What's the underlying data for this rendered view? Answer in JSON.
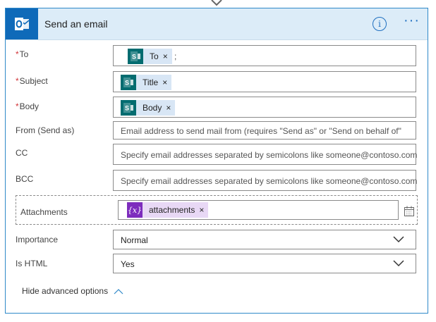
{
  "card": {
    "title": "Send an email",
    "info_glyph": "i",
    "more_glyph": "···",
    "accent_color": "#0f6ab9",
    "header_bg": "#dcecf8"
  },
  "fields": {
    "to": {
      "label": "To",
      "required_mark": "*",
      "token": "To",
      "separator": ";"
    },
    "subject": {
      "label": "Subject",
      "required_mark": "*",
      "token": "Title"
    },
    "body": {
      "label": "Body",
      "required_mark": "*",
      "token": "Body"
    },
    "from": {
      "label": "From (Send as)",
      "placeholder": "Email address to send mail from (requires \"Send as\" or \"Send on behalf of\""
    },
    "cc": {
      "label": "CC",
      "placeholder": "Specify email addresses separated by semicolons like someone@contoso.com"
    },
    "bcc": {
      "label": "BCC",
      "placeholder": "Specify email addresses separated by semicolons like someone@contoso.com"
    },
    "attachments": {
      "label": "Attachments",
      "token": "attachments",
      "token_icon_text": "{x}"
    },
    "importance": {
      "label": "Importance",
      "value": "Normal"
    },
    "is_html": {
      "label": "Is HTML",
      "value": "Yes"
    }
  },
  "token_remove_glyph": "×",
  "advanced": {
    "label": "Hide advanced options"
  }
}
